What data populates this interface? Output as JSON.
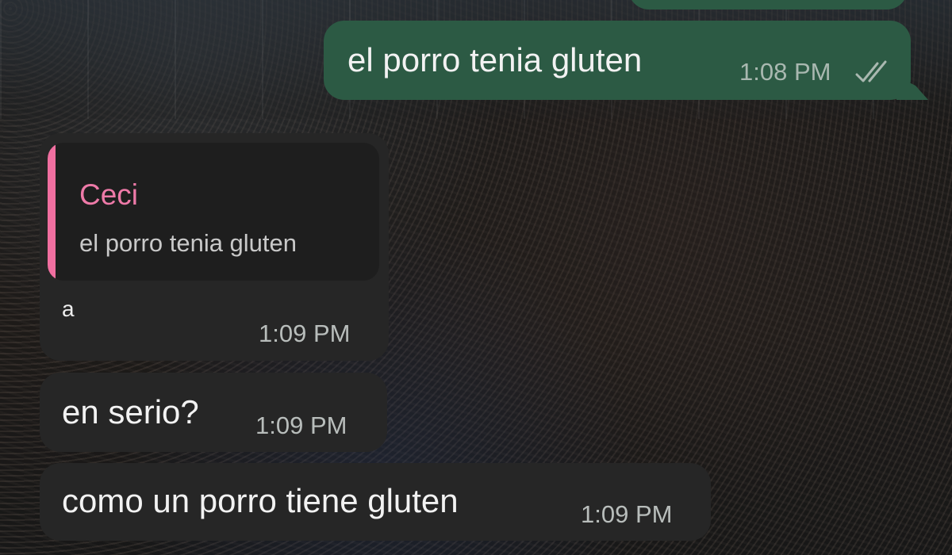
{
  "wallpaper": {
    "icon": "stadium-crowd-wallpaper"
  },
  "colors": {
    "outgoing_bubble": "#2c5a44",
    "incoming_bubble": "#262626",
    "quote_accent": "#f06fa0",
    "quote_author": "#ee7aa8"
  },
  "messages": [
    {
      "direction": "outgoing",
      "text": "el porro tenia gluten",
      "time": "1:08 PM",
      "status_icon": "double-check-read-icon"
    },
    {
      "direction": "incoming",
      "reply_to": {
        "author": "Ceci",
        "text": "el porro tenia gluten"
      },
      "text": "a",
      "time": "1:09 PM"
    },
    {
      "direction": "incoming",
      "text": "en serio?",
      "time": "1:09 PM"
    },
    {
      "direction": "incoming",
      "text": "como un porro tiene gluten",
      "time": "1:09 PM"
    }
  ]
}
